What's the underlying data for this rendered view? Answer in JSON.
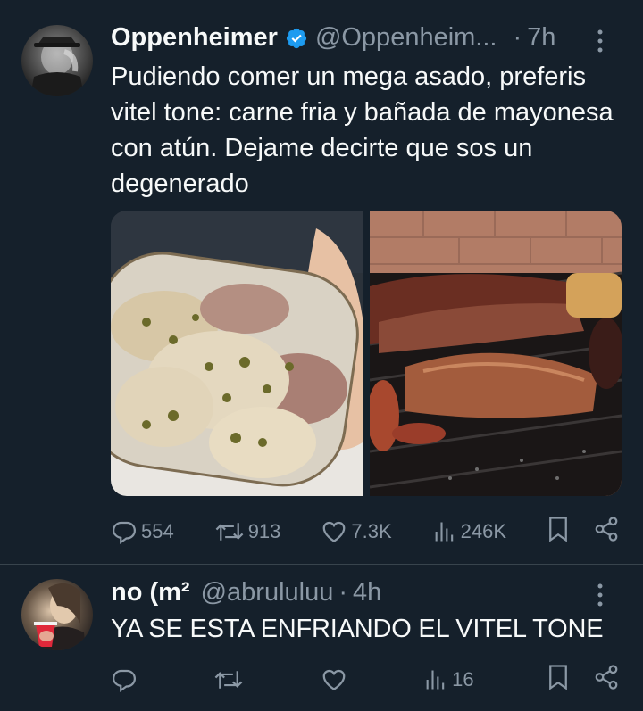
{
  "tweet1": {
    "display_name": "Oppenheimer",
    "handle": "@Oppenheim...",
    "dot": "·",
    "time": "7h",
    "text": "Pudiendo comer un mega asado, preferis vitel tone: carne fria y bañada de mayonesa con atún. Dejame decirte que sos un degenerado",
    "media": [
      "vitel tone plate",
      "asado on grill"
    ],
    "replies": "554",
    "retweets": "913",
    "likes": "7.3K",
    "views": "246K"
  },
  "tweet2": {
    "display_name": "no (m²",
    "handle": "@abrululuu",
    "dot": "·",
    "time": "4h",
    "text": "YA SE ESTA ENFRIANDO EL VITEL TONE",
    "replies": "",
    "retweets": "",
    "likes": "",
    "views": "16"
  },
  "colors": {
    "background": "#15202b",
    "text": "#f7f9f9",
    "muted": "#8b98a5",
    "verified": "#1d9bf0",
    "divider": "#38444d"
  },
  "icons": [
    "verified-badge-icon",
    "more-icon",
    "reply-icon",
    "retweet-icon",
    "like-icon",
    "views-icon",
    "bookmark-icon",
    "share-icon"
  ]
}
